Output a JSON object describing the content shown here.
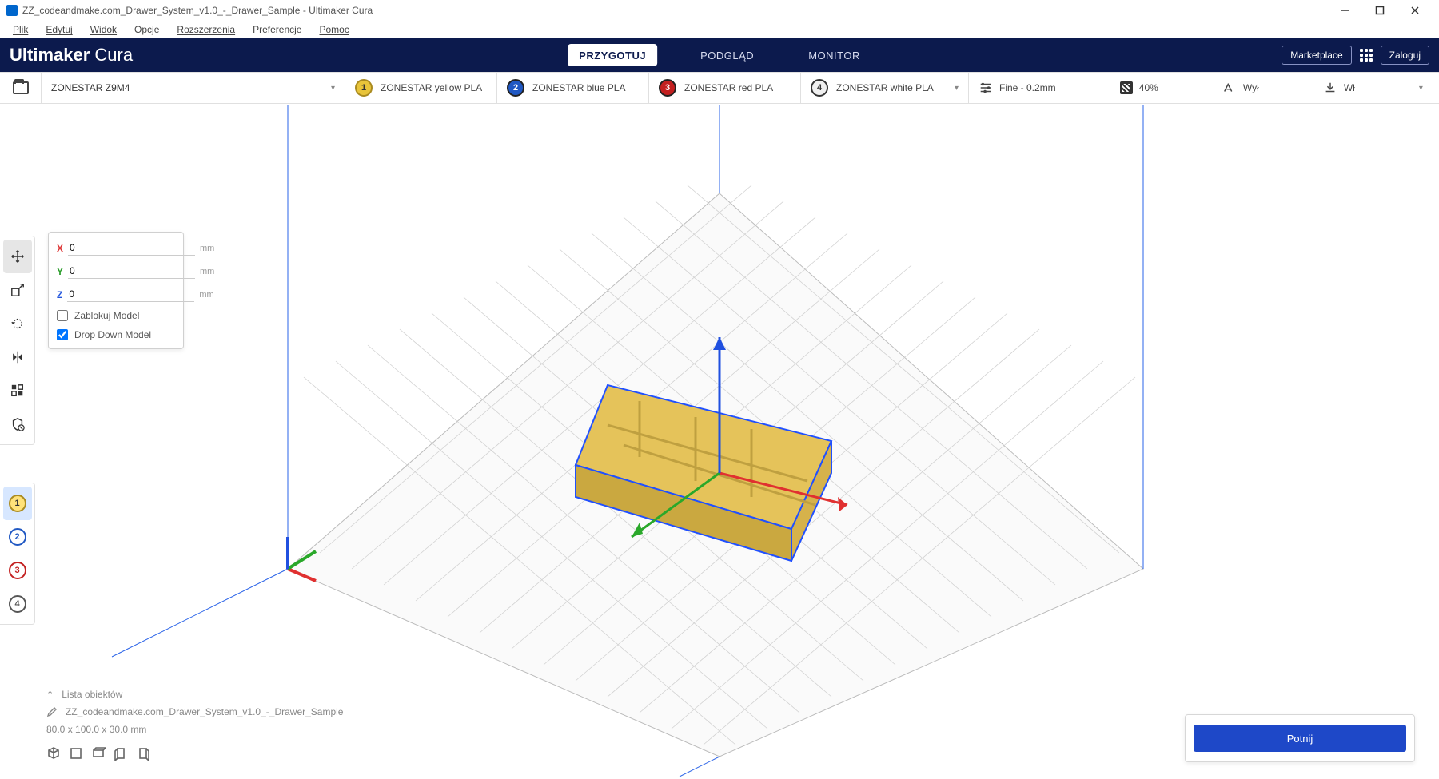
{
  "titlebar": {
    "text": "ZZ_codeandmake.com_Drawer_System_v1.0_-_Drawer_Sample - Ultimaker Cura"
  },
  "menu": {
    "items": [
      "Plik",
      "Edytuj",
      "Widok",
      "Opcje",
      "Rozszerzenia",
      "Preferencje",
      "Pomoc"
    ]
  },
  "brand": {
    "bold": "Ultimaker",
    "light": "Cura"
  },
  "stage_tabs": {
    "prepare": "PRZYGOTUJ",
    "preview": "PODGLĄD",
    "monitor": "MONITOR"
  },
  "header_right": {
    "marketplace": "Marketplace",
    "login": "Zaloguj"
  },
  "printer": {
    "name": "ZONESTAR Z9M4"
  },
  "extruders": [
    {
      "n": "1",
      "label": "ZONESTAR yellow PLA"
    },
    {
      "n": "2",
      "label": "ZONESTAR blue PLA"
    },
    {
      "n": "3",
      "label": "ZONESTAR red PLA"
    },
    {
      "n": "4",
      "label": "ZONESTAR white PLA"
    }
  ],
  "print_settings": {
    "profile": "Fine - 0.2mm",
    "infill": "40%",
    "support": "Wył",
    "adhesion": "Wł"
  },
  "transform": {
    "x": "0",
    "y": "0",
    "z": "0",
    "unit": "mm",
    "lock_label": "Zablokuj Model",
    "drop_label": "Drop Down Model",
    "lock_checked": false,
    "drop_checked": true
  },
  "object_list": {
    "heading": "Lista obiektów",
    "item": "ZZ_codeandmake.com_Drawer_System_v1.0_-_Drawer_Sample",
    "dims": "80.0 x 100.0 x 30.0 mm"
  },
  "slice": {
    "button": "Potnij"
  }
}
